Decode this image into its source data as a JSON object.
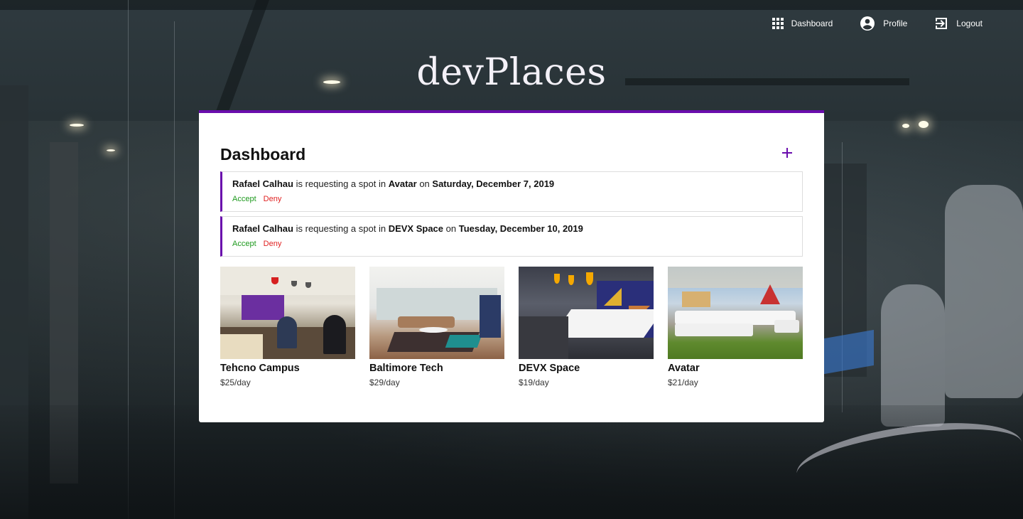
{
  "app": {
    "logo": "devPlaces"
  },
  "nav": {
    "dashboard_label": "Dashboard",
    "profile_label": "Profile",
    "logout_label": "Logout"
  },
  "dashboard": {
    "title": "Dashboard",
    "add_icon": "plus-icon",
    "accent_color": "#6a0dad"
  },
  "requests": [
    {
      "user": "Rafael Calhau",
      "text_middle": "is requesting a spot in",
      "place": "Avatar",
      "text_on": "on",
      "date": "Saturday, December 7, 2019",
      "accept_label": "Accept",
      "deny_label": "Deny"
    },
    {
      "user": "Rafael Calhau",
      "text_middle": "is requesting a spot in",
      "place": "DEVX Space",
      "text_on": "on",
      "date": "Tuesday, December 10, 2019",
      "accept_label": "Accept",
      "deny_label": "Deny"
    }
  ],
  "spots": [
    {
      "name": "Tehcno Campus",
      "price": "$25/day"
    },
    {
      "name": "Baltimore Tech",
      "price": "$29/day"
    },
    {
      "name": "DEVX Space",
      "price": "$19/day"
    },
    {
      "name": "Avatar",
      "price": "$21/day"
    }
  ],
  "colors": {
    "accept": "#1e9a1e",
    "deny": "#e02020"
  }
}
